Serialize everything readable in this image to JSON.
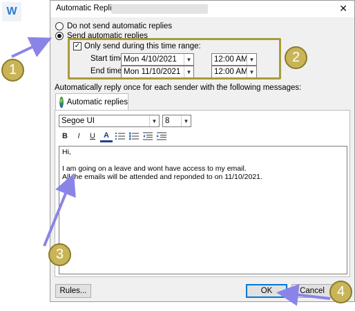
{
  "app_logo": {
    "letter": "W",
    "icon": "app-logo-icon"
  },
  "dialog": {
    "title": "Automatic Replies -",
    "close_glyph": "✕",
    "radio_off_label": "Do not send automatic replies",
    "radio_on_label": "Send automatic replies",
    "time_range_label": "Only send during this time range:",
    "time_range_checked": true,
    "start_label": "Start time:",
    "start_date": "Mon 4/10/2021",
    "start_time": "12:00 AM",
    "end_label": "End time:",
    "end_date": "Mon 11/10/2021",
    "end_time": "12:00 AM",
    "reply_once_label": "Automatically reply once for each sender with the following messages:",
    "tab_label": "Automatic replies",
    "font_name": "Segoe UI",
    "font_size": "8",
    "toolbar": {
      "bold": "B",
      "italic": "I",
      "underline": "U",
      "font_color": "A"
    },
    "message_lines": [
      "Hi,",
      "",
      "I am going on a leave and wont have access to my email.",
      "All the emails will be attended and reponded to on 11/10/2021."
    ],
    "rules_button": "Rules...",
    "ok_button": "OK",
    "cancel_button": "Cancel"
  },
  "callouts": [
    "1",
    "2",
    "3",
    "4"
  ],
  "colors": {
    "badge_fill": "#c9b557",
    "highlight_border": "#a89b3b",
    "arrow": "#8b84e8",
    "ok_border": "#0078d7"
  }
}
